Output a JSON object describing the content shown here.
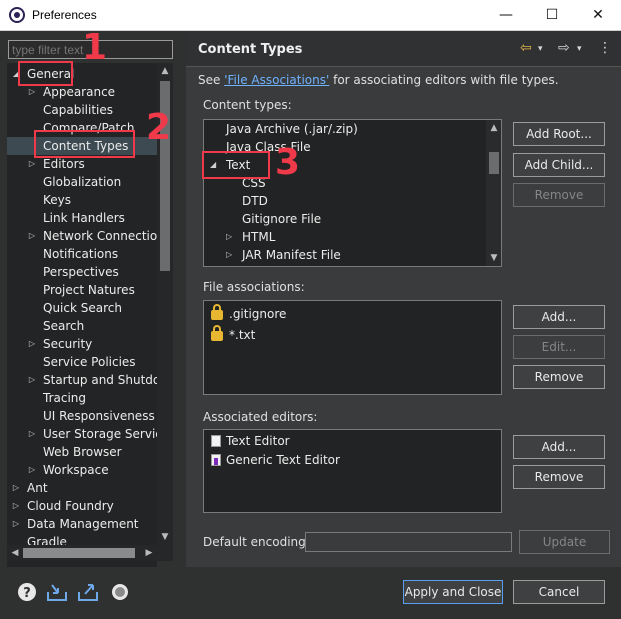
{
  "window": {
    "title": "Preferences",
    "minimize": "—",
    "maximize": "☐",
    "close": "✕"
  },
  "filter": {
    "placeholder": "type filter text"
  },
  "tree": [
    {
      "label": "General",
      "depth": 0,
      "arrow": "◢"
    },
    {
      "label": "Appearance",
      "depth": 1,
      "arrow": "▷"
    },
    {
      "label": "Capabilities",
      "depth": 1,
      "arrow": ""
    },
    {
      "label": "Compare/Patch",
      "depth": 1,
      "arrow": ""
    },
    {
      "label": "Content Types",
      "depth": 1,
      "arrow": "",
      "selected": true
    },
    {
      "label": "Editors",
      "depth": 1,
      "arrow": "▷"
    },
    {
      "label": "Globalization",
      "depth": 1,
      "arrow": ""
    },
    {
      "label": "Keys",
      "depth": 1,
      "arrow": ""
    },
    {
      "label": "Link Handlers",
      "depth": 1,
      "arrow": ""
    },
    {
      "label": "Network Connections",
      "depth": 1,
      "arrow": "▷"
    },
    {
      "label": "Notifications",
      "depth": 1,
      "arrow": ""
    },
    {
      "label": "Perspectives",
      "depth": 1,
      "arrow": ""
    },
    {
      "label": "Project Natures",
      "depth": 1,
      "arrow": ""
    },
    {
      "label": "Quick Search",
      "depth": 1,
      "arrow": ""
    },
    {
      "label": "Search",
      "depth": 1,
      "arrow": ""
    },
    {
      "label": "Security",
      "depth": 1,
      "arrow": "▷"
    },
    {
      "label": "Service Policies",
      "depth": 1,
      "arrow": ""
    },
    {
      "label": "Startup and Shutdown",
      "depth": 1,
      "arrow": "▷"
    },
    {
      "label": "Tracing",
      "depth": 1,
      "arrow": ""
    },
    {
      "label": "UI Responsiveness Monitoring",
      "depth": 1,
      "arrow": ""
    },
    {
      "label": "User Storage Service",
      "depth": 1,
      "arrow": "▷"
    },
    {
      "label": "Web Browser",
      "depth": 1,
      "arrow": ""
    },
    {
      "label": "Workspace",
      "depth": 1,
      "arrow": "▷"
    },
    {
      "label": "Ant",
      "depth": 0,
      "arrow": "▷"
    },
    {
      "label": "Cloud Foundry",
      "depth": 0,
      "arrow": "▷"
    },
    {
      "label": "Data Management",
      "depth": 0,
      "arrow": "▷"
    },
    {
      "label": "Gradle",
      "depth": 0,
      "arrow": ""
    }
  ],
  "page": {
    "title": "Content Types",
    "see_prefix": "See ",
    "see_link": "'File Associations'",
    "see_suffix": " for associating editors with file types.",
    "content_types_label": "Content types:",
    "content_types": [
      {
        "label": "Java Archive (.jar/.zip)",
        "depth": 1,
        "arrow": ""
      },
      {
        "label": "Java Class File",
        "depth": 1,
        "arrow": ""
      },
      {
        "label": "Text",
        "depth": 0,
        "arrow": "◢"
      },
      {
        "label": "CSS",
        "depth": 2,
        "arrow": ""
      },
      {
        "label": "DTD",
        "depth": 2,
        "arrow": ""
      },
      {
        "label": "Gitignore File",
        "depth": 2,
        "arrow": ""
      },
      {
        "label": "HTML",
        "depth": 2,
        "arrow": "▷"
      },
      {
        "label": "JAR Manifest File",
        "depth": 2,
        "arrow": "▷"
      }
    ],
    "buttons_ct": {
      "add_root": "Add Root...",
      "add_child": "Add Child...",
      "remove": "Remove"
    },
    "file_assoc_label": "File associations:",
    "file_assoc": [
      ".gitignore",
      "*.txt"
    ],
    "buttons_fa": {
      "add": "Add...",
      "edit": "Edit...",
      "remove": "Remove"
    },
    "editors_label": "Associated editors:",
    "editors": [
      {
        "label": "Text Editor",
        "icon": "text-editor-icon"
      },
      {
        "label": "Generic Text Editor",
        "icon": "generic-editor-icon"
      }
    ],
    "buttons_ed": {
      "add": "Add...",
      "remove": "Remove"
    },
    "encoding_label": "Default encoding:",
    "update": "Update"
  },
  "footer": {
    "apply_close": "Apply and Close",
    "cancel": "Cancel"
  },
  "annotations": [
    "1",
    "2",
    "3"
  ],
  "colors": {
    "annotation": "#f03a4a",
    "link": "#6fb3ff",
    "lock": "#e7b731"
  }
}
